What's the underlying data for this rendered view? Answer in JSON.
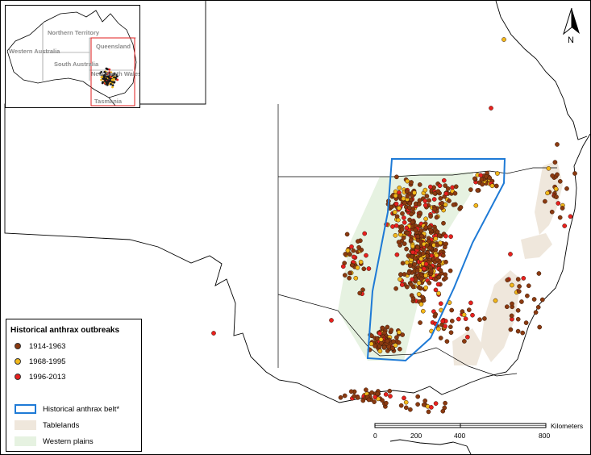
{
  "colors": {
    "period_1914_1963": "#8b3a10",
    "period_1968_1995": "#f2b81a",
    "period_1996_2013": "#e8201e",
    "anthrax_belt": "#1e7ad6",
    "tablelands": "#efe7dc",
    "western_plains": "#e6f2e1",
    "coastline": "#000000",
    "inset_box": "#e01c1c"
  },
  "inset_map": {
    "labels": {
      "northern_territory": "Northern Territory",
      "queensland": "Queensland",
      "western_australia": "Western Australia",
      "south_australia": "South Australia",
      "new_south_wales": "New South Wales",
      "tasmania": "Tasmania"
    }
  },
  "legend": {
    "title": "Historical anthrax outbreaks",
    "periods": [
      {
        "label": "1914-1963",
        "color": "#8b3a10"
      },
      {
        "label": "1968-1995",
        "color": "#f2b81a"
      },
      {
        "label": "1996-2013",
        "color": "#e8201e"
      }
    ],
    "areas": [
      {
        "label": "Historical anthrax belt*",
        "style": "outline",
        "color": "#1e7ad6"
      },
      {
        "label": "Tablelands",
        "style": "fill",
        "color": "#efe7dc"
      },
      {
        "label": "Western plains",
        "style": "fill",
        "color": "#e6f2e1"
      }
    ]
  },
  "scale_bar": {
    "unit": "Kilometers",
    "ticks": [
      "0",
      "200",
      "400",
      "800"
    ]
  },
  "north_arrow": {
    "label": "N"
  }
}
